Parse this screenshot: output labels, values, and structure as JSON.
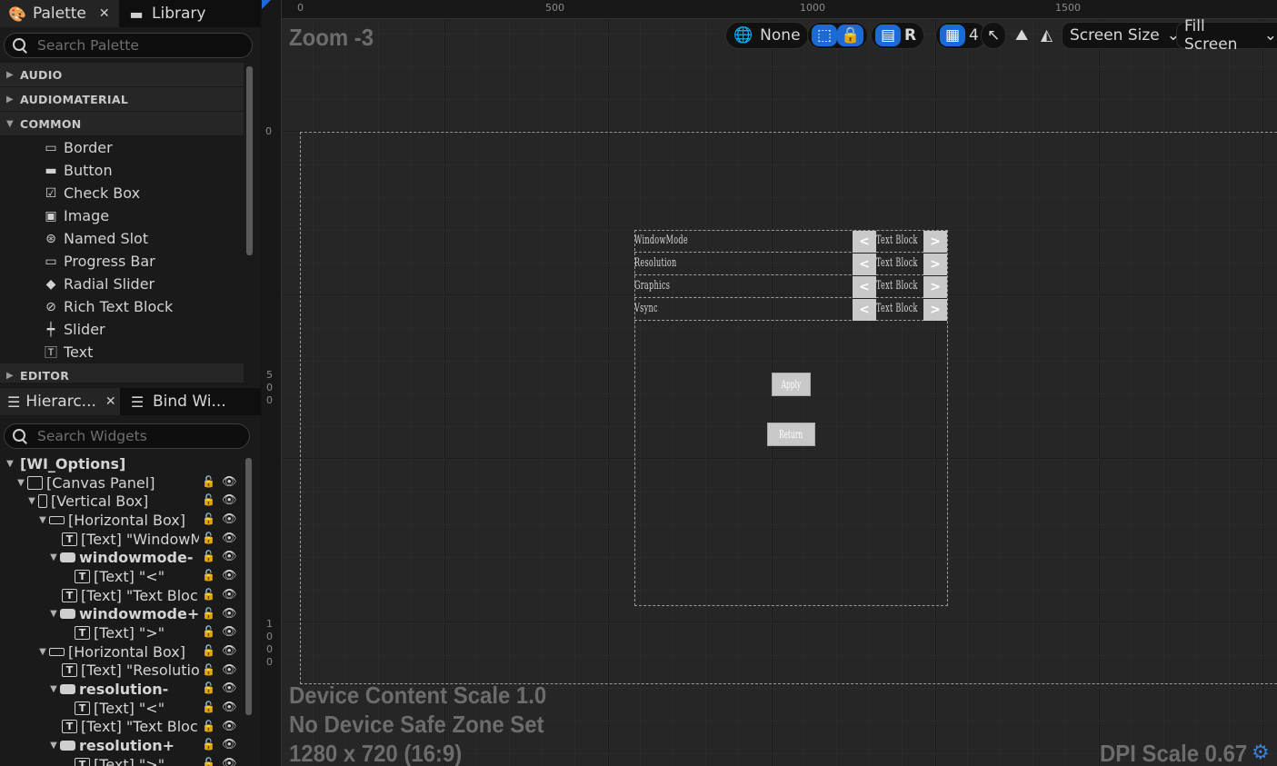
{
  "palette_tabs": {
    "palette": "Palette",
    "library": "Library"
  },
  "palette_search": {
    "placeholder": "Search Palette"
  },
  "palette": {
    "categories": [
      "AUDIO",
      "AUDIOMATERIAL",
      "COMMON",
      "EDITOR"
    ],
    "common_items": [
      "Border",
      "Button",
      "Check Box",
      "Image",
      "Named Slot",
      "Progress Bar",
      "Radial Slider",
      "Rich Text Block",
      "Slider",
      "Text"
    ]
  },
  "hier_tabs": {
    "hierarchy": "Hierarc...",
    "bind": "Bind Wi..."
  },
  "hier_search": {
    "placeholder": "Search Widgets"
  },
  "hierarchy": [
    "[WI_Options]",
    "[Canvas Panel]",
    "[Vertical Box]",
    "[Horizontal Box]",
    "[Text] \"WindowM",
    "windowmode-",
    "[Text] \"<\"",
    "[Text] \"Text Bloc",
    "windowmode+",
    "[Text] \">\"",
    "[Horizontal Box]",
    "[Text] \"Resolutio",
    "resolution-",
    "[Text] \"<\"",
    "[Text] \"Text Bloc",
    "resolution+",
    "[Text] \">\""
  ],
  "ruler": {
    "h": [
      "0",
      "500",
      "1000",
      "1500"
    ],
    "v": [
      "0",
      "5\n0\n0",
      "1\n0\n0\n0"
    ]
  },
  "viewport": {
    "zoom": "Zoom -3",
    "toolbar": {
      "none": "None",
      "r": "R",
      "grid": "4",
      "screen_size": "Screen Size",
      "fill_screen": "Fill Screen"
    },
    "bottom": [
      "Device Content Scale 1.0",
      "No Device Safe Zone Set",
      "1280 x 720 (16:9)"
    ],
    "dpi": "DPI Scale 0.67"
  },
  "widget": {
    "rows": [
      "WindowMode",
      "Resolution",
      "Graphics",
      "Vsync"
    ],
    "value": "Text Block",
    "left": "<",
    "right": ">",
    "apply": "Apply",
    "return": "Return"
  }
}
